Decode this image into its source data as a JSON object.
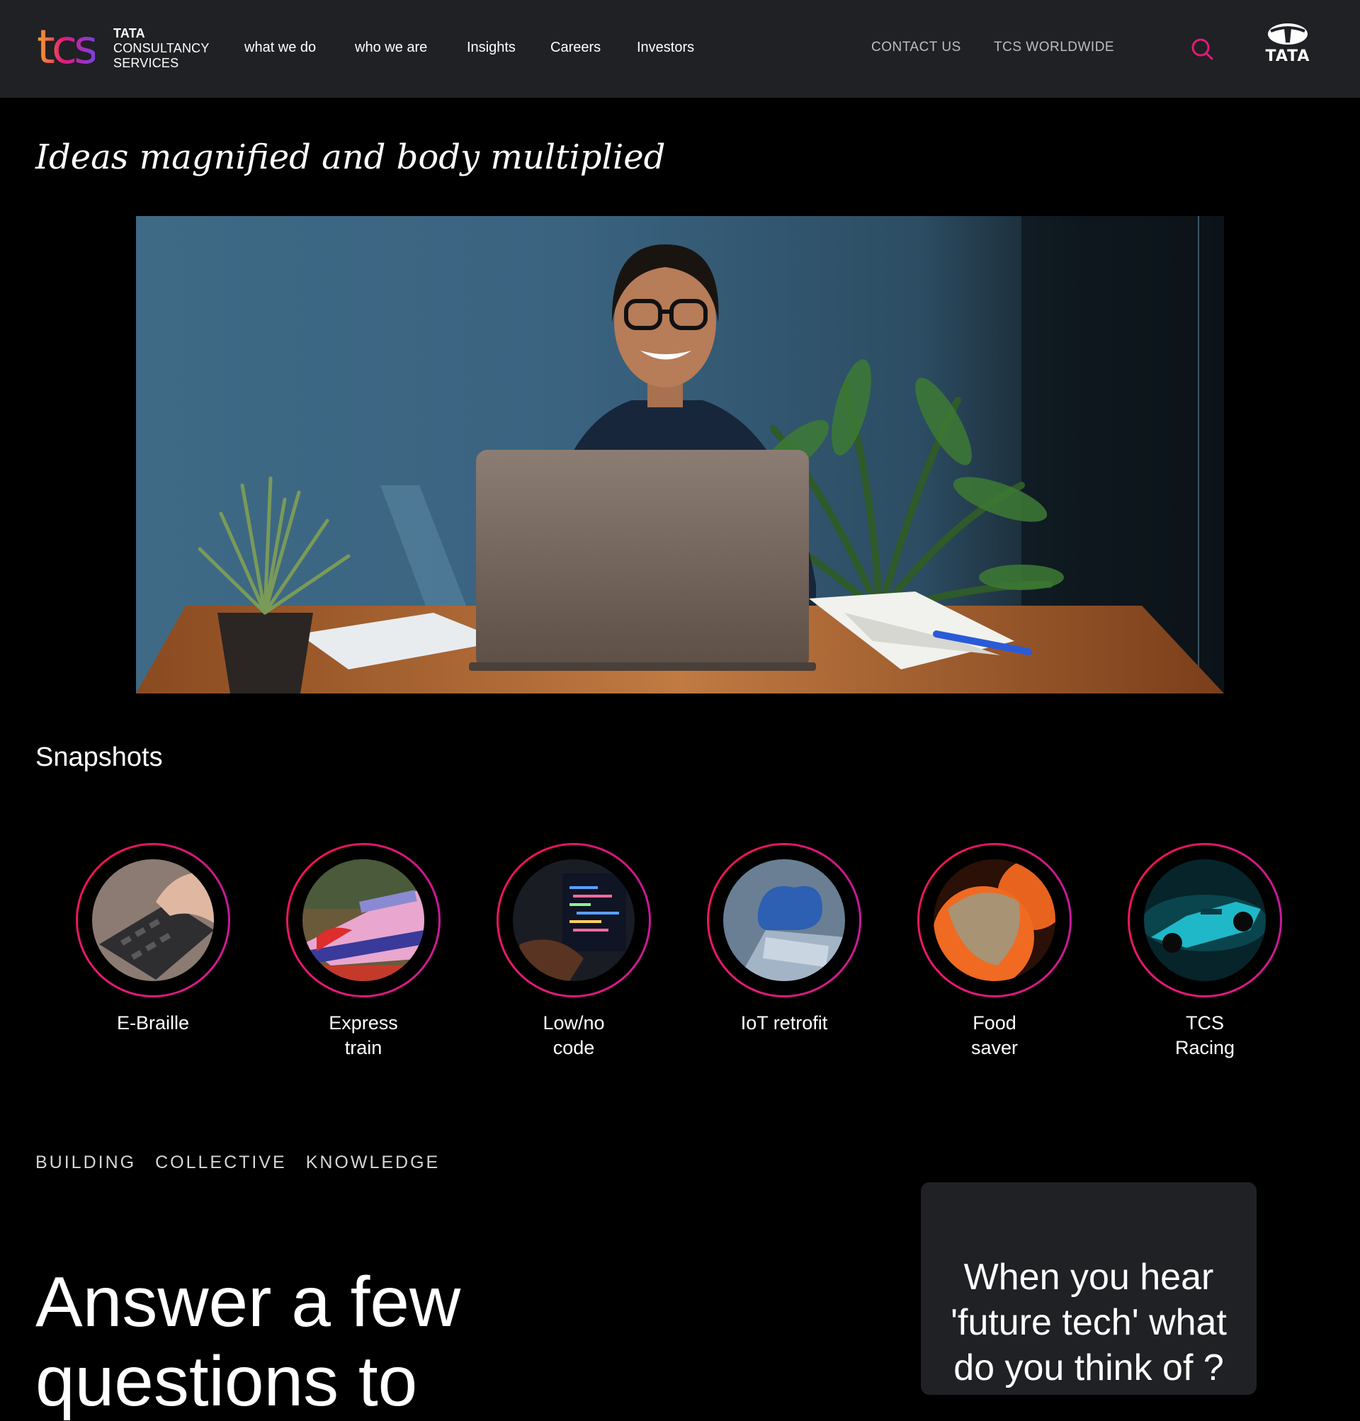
{
  "header": {
    "logo": {
      "mark": "tcs",
      "lines": [
        "TATA",
        "CONSULTANCY",
        "SERVICES"
      ]
    },
    "nav": [
      "what we do",
      "who we are",
      "Insights",
      "Careers",
      "Investors"
    ],
    "utility": [
      "CONTACT US",
      "TCS WORLDWIDE"
    ],
    "search_icon": "search-icon",
    "brand_logo": "TATA"
  },
  "hero": {
    "tagline": "Ideas magnified and body multiplied"
  },
  "snapshots": {
    "title": "Snapshots",
    "items": [
      {
        "label": "E-Braille"
      },
      {
        "label": "Express train"
      },
      {
        "label": "Low/no code"
      },
      {
        "label": "IoT retrofit"
      },
      {
        "label": "Food saver"
      },
      {
        "label": "TCS Racing"
      }
    ]
  },
  "knowledge": {
    "kicker": [
      "BUILDING",
      "COLLECTIVE",
      "KNOWLEDGE"
    ],
    "headline": "Answer a few questions to",
    "quiz_question": "When you hear 'future tech' what do you think of ?"
  },
  "colors": {
    "header_bg": "#1f2124",
    "accent": "#e5197a",
    "page_bg": "#000000"
  }
}
